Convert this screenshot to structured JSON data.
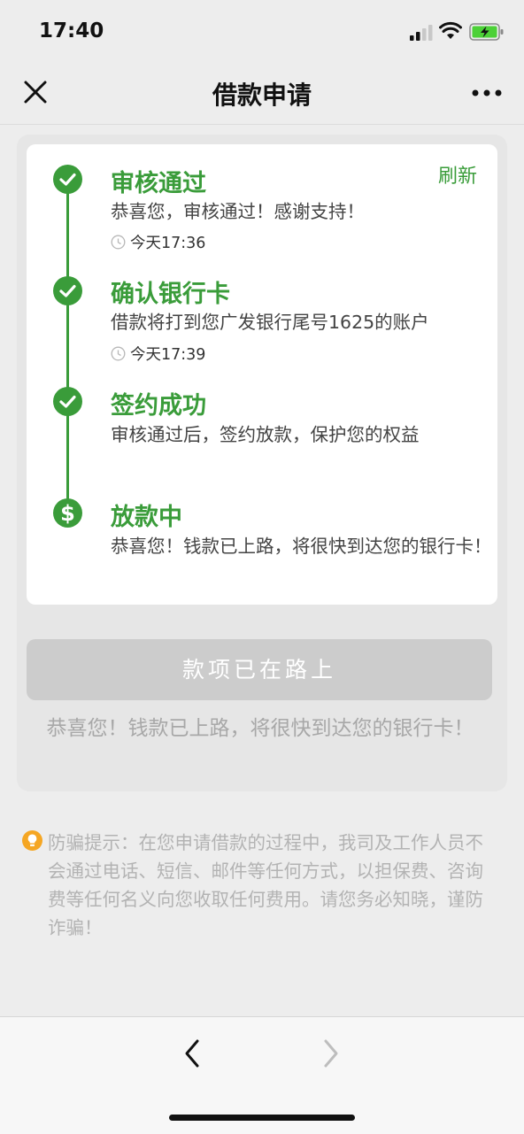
{
  "status_bar": {
    "time": "17:40"
  },
  "nav": {
    "title": "借款申请",
    "close_icon": "close-icon",
    "more_icon": "more-icon"
  },
  "timeline": {
    "refresh_label": "刷新",
    "steps": [
      {
        "title": "审核通过",
        "desc": "恭喜您，审核通过！感谢支持！",
        "time": "今天17:36",
        "icon": "check-icon"
      },
      {
        "title": "确认银行卡",
        "desc": "借款将打到您广发银行尾号1625的账户",
        "time": "今天17:39",
        "icon": "check-icon"
      },
      {
        "title": "签约成功",
        "desc": "审核通过后，签约放款，保护您的权益",
        "icon": "check-icon"
      },
      {
        "title": "放款中",
        "desc": "恭喜您！钱款已上路，将很快到达您的银行卡！",
        "icon": "dollar-icon"
      }
    ]
  },
  "button": {
    "label": "款项已在路上"
  },
  "status_note": "恭喜您！钱款已上路，将很快到达您的银行卡！",
  "warning": {
    "text": "防骗提示：在您申请借款的过程中，我司及工作人员不会通过电话、短信、邮件等任何方式，以担保费、咨询费等任何名义向您收取任何费用。请您务必知晓，谨防诈骗！",
    "icon": "bulb-icon"
  },
  "colors": {
    "accent_green": "#3a9c3a",
    "warning_orange": "#f5a623",
    "disabled_button": "#cccccc"
  }
}
